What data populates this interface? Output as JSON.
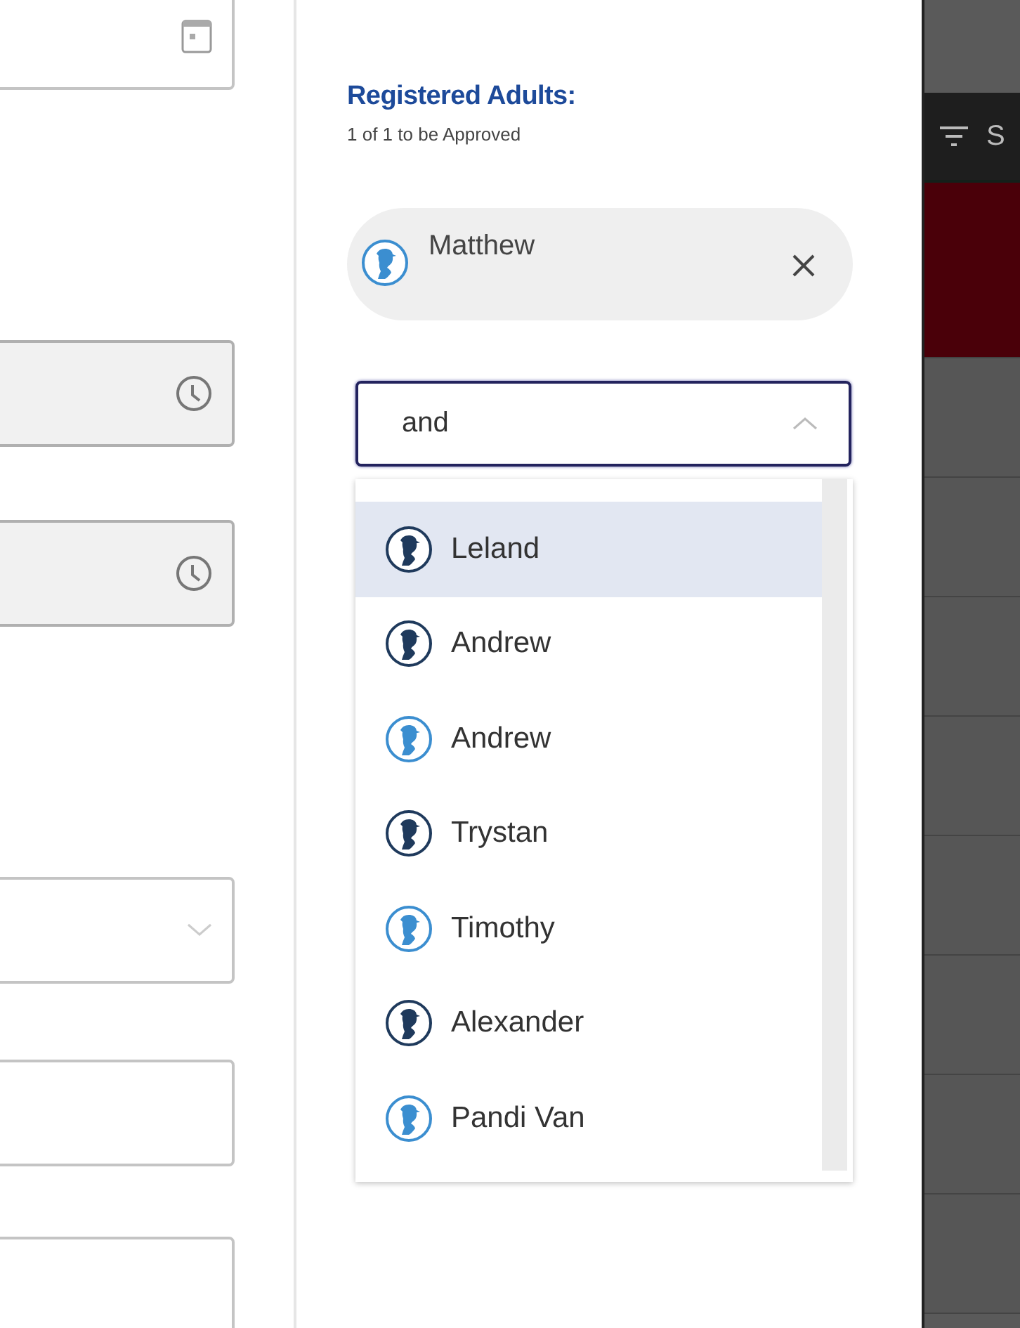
{
  "form": {
    "fields": [
      {
        "kind": "date",
        "disabled": false
      },
      {
        "kind": "time",
        "disabled": true
      },
      {
        "kind": "time",
        "disabled": true
      },
      {
        "kind": "select",
        "disabled": false
      },
      {
        "kind": "text",
        "disabled": false
      },
      {
        "kind": "text",
        "disabled": false
      }
    ]
  },
  "adults_panel": {
    "title": "Registered Adults:",
    "subtitle": "1 of 1 to be Approved",
    "chips": [
      {
        "name": "Matthew",
        "color": "#3b8ed0"
      }
    ],
    "search": {
      "value": "and",
      "expanded": true
    },
    "options": [
      {
        "name": "Leland",
        "color": "#1f3a5c",
        "selected": true
      },
      {
        "name": "Andrew",
        "color": "#1f3a5c",
        "selected": false
      },
      {
        "name": "Andrew",
        "color": "#3b8ed0",
        "selected": false
      },
      {
        "name": "Trystan",
        "color": "#1f3a5c",
        "selected": false
      },
      {
        "name": "Timothy",
        "color": "#3b8ed0",
        "selected": false
      },
      {
        "name": "Alexander",
        "color": "#1f3a5c",
        "selected": false
      },
      {
        "name": "Pandi Van",
        "color": "#3b8ed0",
        "selected": false
      }
    ]
  },
  "side_table": {
    "header": "S",
    "rows": [
      {
        "selected": true
      },
      {
        "selected": false
      },
      {
        "selected": false
      },
      {
        "selected": false
      },
      {
        "selected": false
      },
      {
        "selected": false
      },
      {
        "selected": false
      },
      {
        "selected": false
      },
      {
        "selected": false
      }
    ]
  }
}
